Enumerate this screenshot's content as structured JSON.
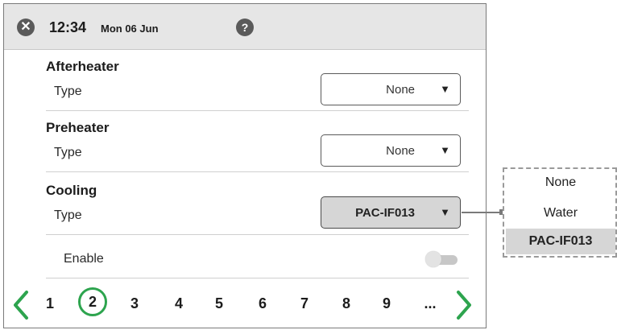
{
  "header": {
    "time": "12:34",
    "date": "Mon 06 Jun",
    "close_icon": "close-icon",
    "help_icon": "help-icon",
    "close_glyph": "✕",
    "help_glyph": "?"
  },
  "sections": {
    "afterheater": {
      "title": "Afterheater",
      "type_label": "Type",
      "value": "None"
    },
    "preheater": {
      "title": "Preheater",
      "type_label": "Type",
      "value": "None"
    },
    "cooling": {
      "title": "Cooling",
      "type_label": "Type",
      "value": "PAC-IF013"
    }
  },
  "enable": {
    "label": "Enable",
    "state": "off"
  },
  "pager": {
    "pages": [
      "1",
      "2",
      "3",
      "4",
      "5",
      "6",
      "7",
      "8",
      "9",
      "..."
    ],
    "current": "2"
  },
  "dropdown": {
    "options": [
      "None",
      "Water",
      "PAC-IF013"
    ],
    "selected": "PAC-IF013"
  },
  "colors": {
    "accent": "#2da44e",
    "header_bg": "#e6e6e6",
    "selected_bg": "#d6d6d6"
  },
  "arrow_glyph": "▼"
}
